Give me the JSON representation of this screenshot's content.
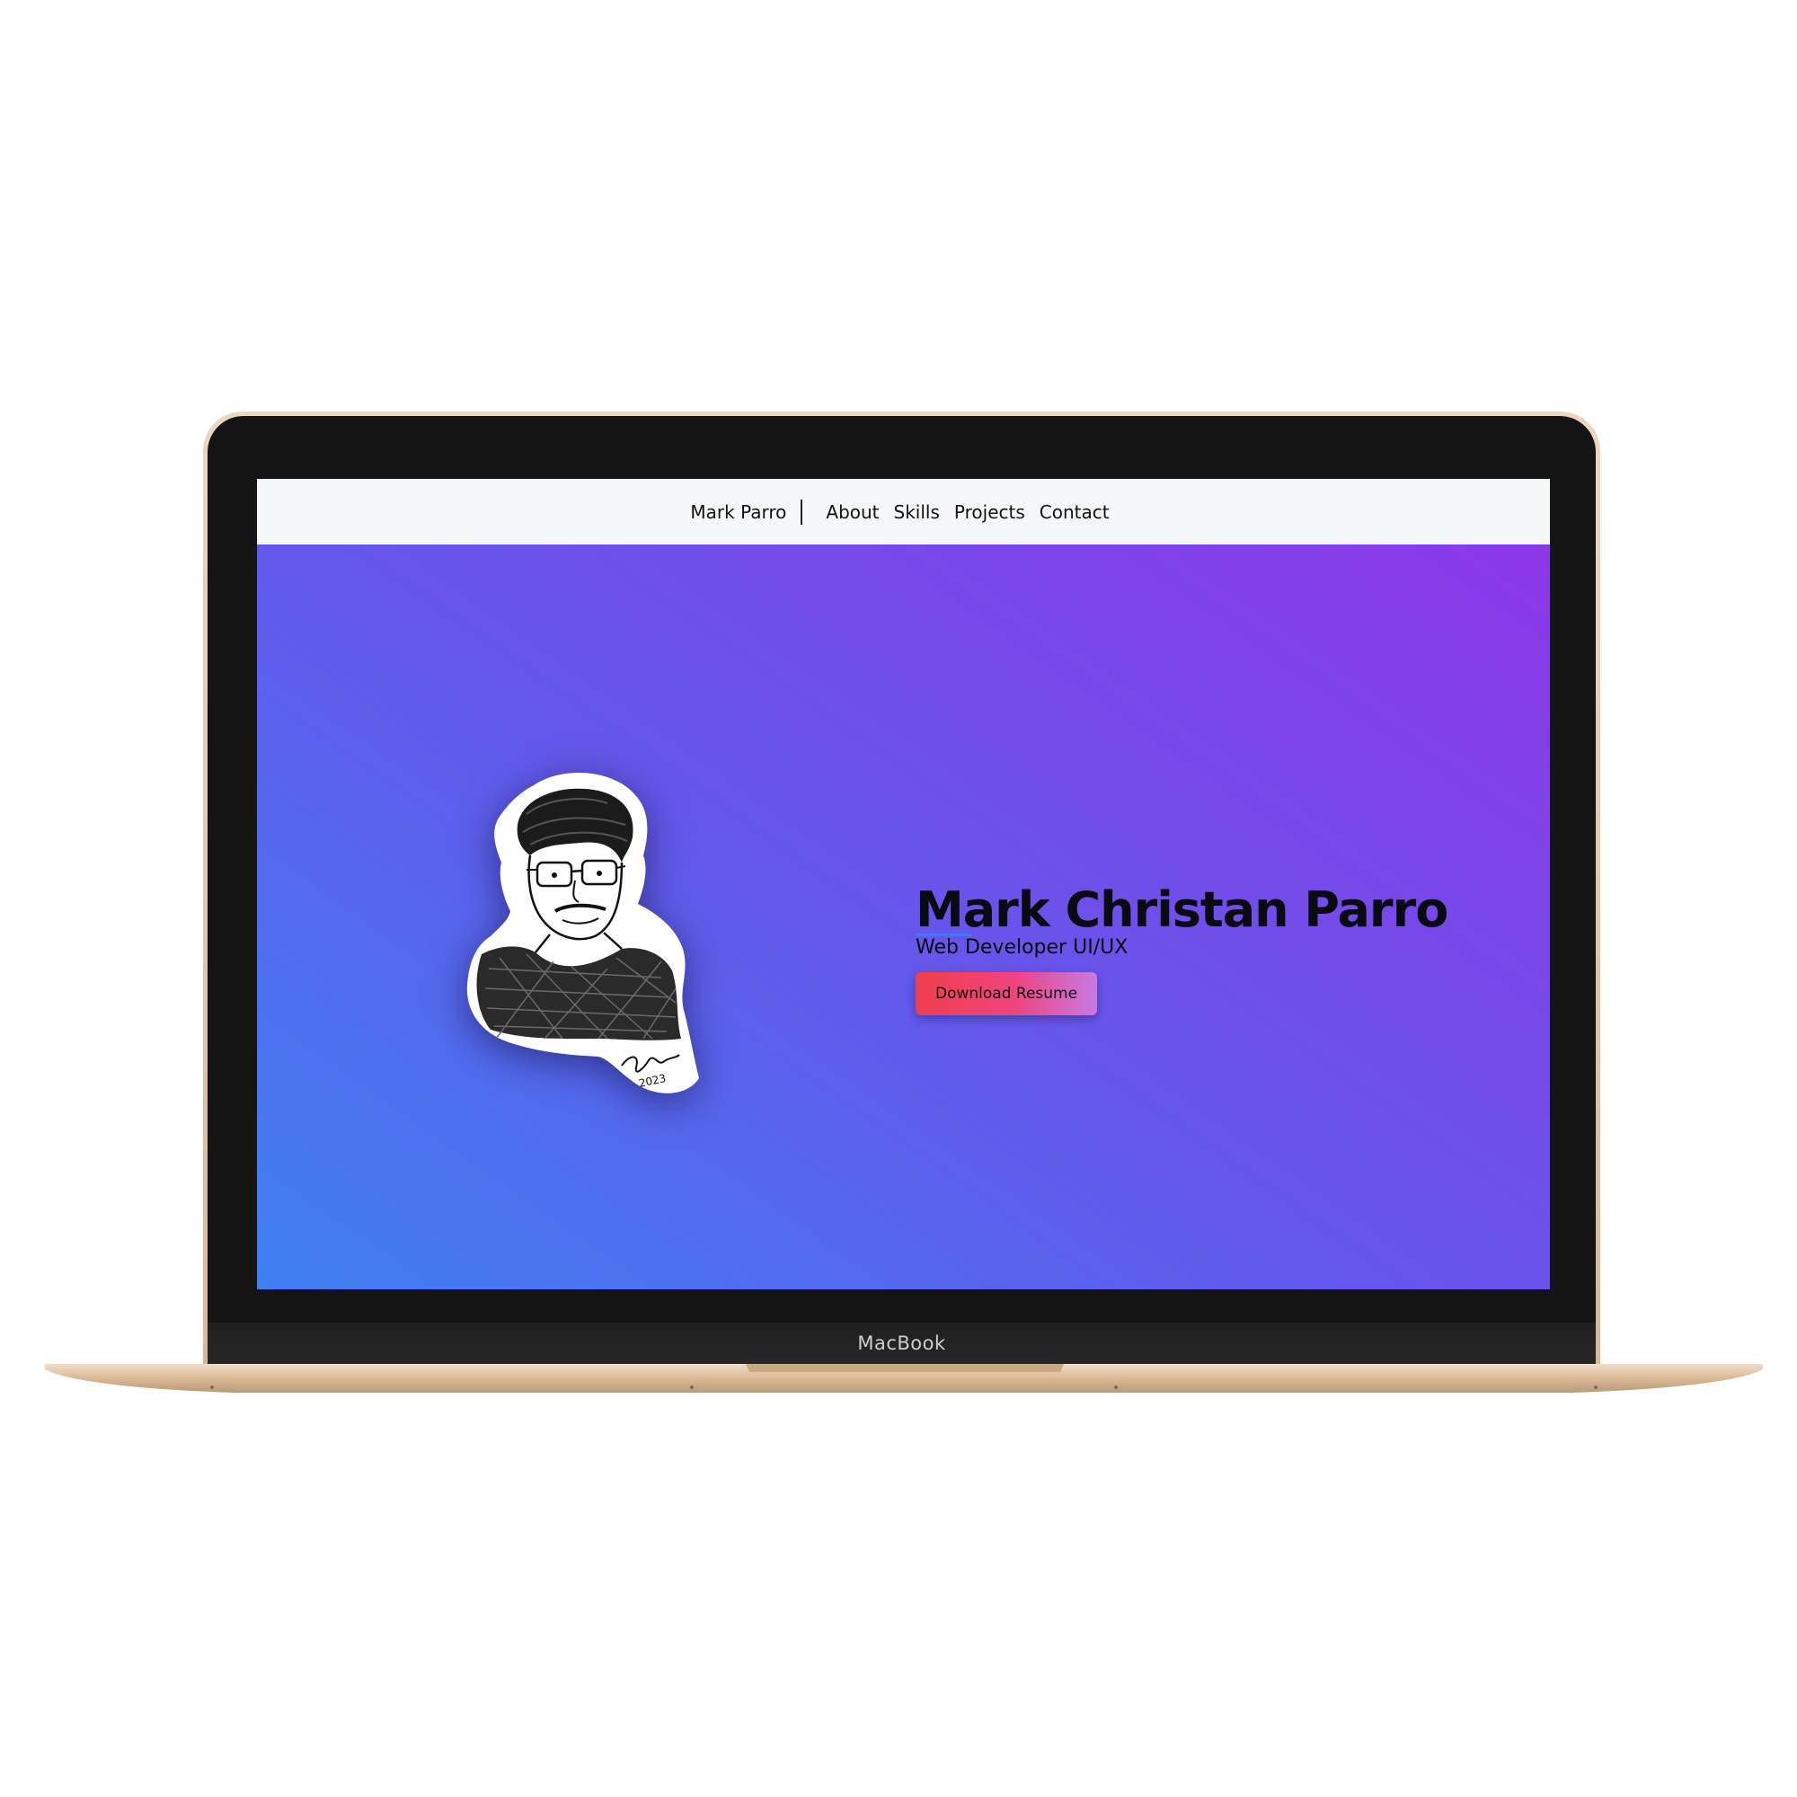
{
  "device": {
    "brand_label": "MacBook"
  },
  "navbar": {
    "brand": "Mark Parro",
    "links": [
      "About",
      "Skills",
      "Projects",
      "Contact"
    ]
  },
  "hero": {
    "title": "Mark Christan Parro",
    "subtitle": "Web Developer UI/UX",
    "button_label": "Download Resume",
    "portrait_signature": "2023",
    "colors": {
      "gradient_start": "#3f80f3",
      "gradient_mid": "#6259ea",
      "gradient_end": "#8d37e8",
      "button_start": "#ef3e4d",
      "button_end": "#c77ae3",
      "underline": "#3b7bf3"
    }
  }
}
